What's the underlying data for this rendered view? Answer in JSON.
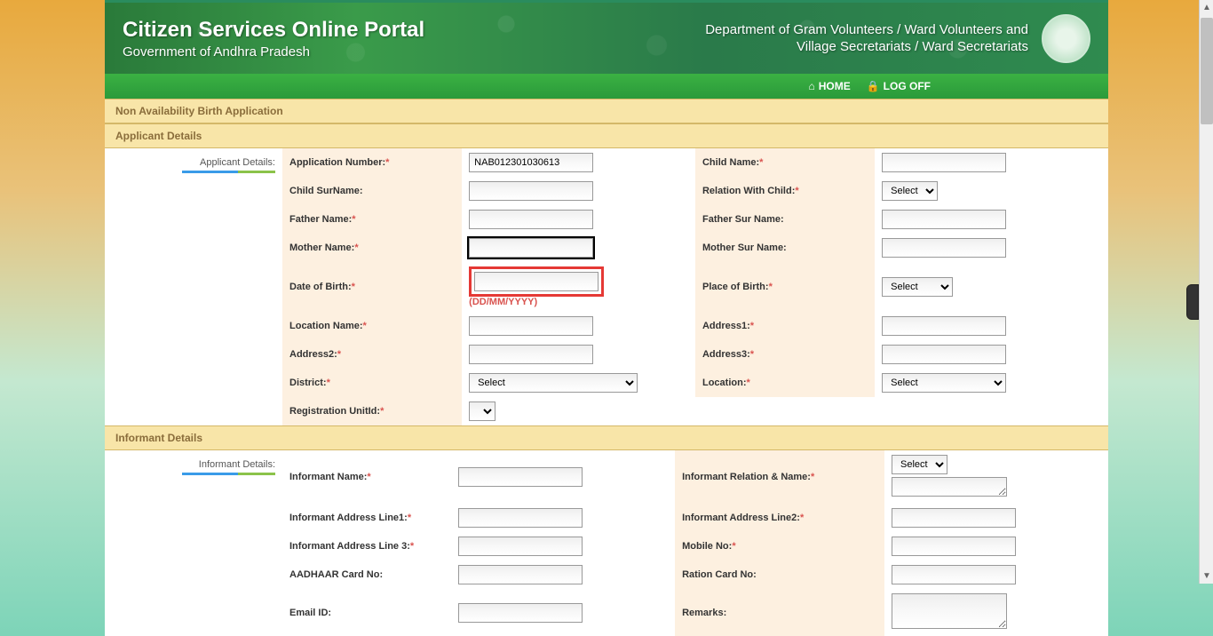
{
  "header": {
    "portal_title": "Citizen Services Online Portal",
    "portal_subtitle": "Government of Andhra Pradesh",
    "department_line1": "Department of Gram Volunteers / Ward Volunteers and",
    "department_line2": "Village Secretariats / Ward Secretariats"
  },
  "nav": {
    "home": "HOME",
    "logoff": "LOG OFF"
  },
  "sections": {
    "page_title": "Non Availability Birth Application",
    "applicant_details": "Applicant Details",
    "informant_details": "Informant Details",
    "applicant_side": "Applicant Details:",
    "informant_side": "Informant Details:"
  },
  "labels": {
    "application_number": "Application Number:",
    "child_name": "Child Name:",
    "child_surname": "Child SurName:",
    "relation_with_child": "Relation With Child:",
    "father_name": "Father Name:",
    "father_surname": "Father Sur Name:",
    "mother_name": "Mother Name:",
    "mother_surname": "Mother Sur Name:",
    "date_of_birth": "Date of Birth:",
    "dob_format": "(DD/MM/YYYY)",
    "place_of_birth": "Place of Birth:",
    "location_name": "Location Name:",
    "address1": "Address1:",
    "address2": "Address2:",
    "address3": "Address3:",
    "district": "District:",
    "location": "Location:",
    "registration_unitid": "Registration UnitId:",
    "informant_name": "Informant Name:",
    "informant_relation_name": "Informant Relation & Name:",
    "informant_addr1": "Informant Address Line1:",
    "informant_addr2": "Informant Address Line2:",
    "informant_addr3": "Informant Address Line 3:",
    "mobile_no": "Mobile No:",
    "aadhaar": "AADHAAR Card No:",
    "ration_card": "Ration Card No:",
    "email_id": "Email ID:",
    "remarks": "Remarks:"
  },
  "values": {
    "application_number": "NAB012301030613"
  },
  "options": {
    "select_default": "Select"
  }
}
